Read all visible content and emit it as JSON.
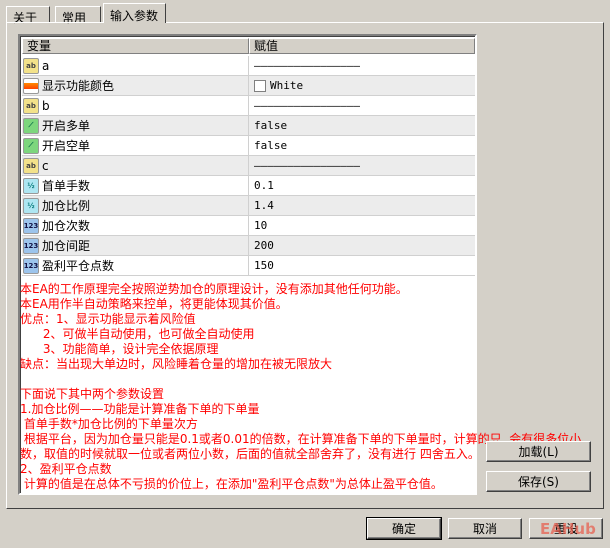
{
  "tabs": [
    {
      "label": "关于"
    },
    {
      "label": "常用"
    },
    {
      "label": "输入参数"
    }
  ],
  "table": {
    "headers": [
      "变量",
      "赋值"
    ],
    "rows": [
      {
        "icon": "string",
        "name": "a",
        "value": "————————————————"
      },
      {
        "icon": "color",
        "name": "显示功能颜色",
        "value": "White"
      },
      {
        "icon": "string",
        "name": "b",
        "value": "————————————————"
      },
      {
        "icon": "bool",
        "name": "开启多单",
        "value": "false"
      },
      {
        "icon": "bool",
        "name": "开启空单",
        "value": "false"
      },
      {
        "icon": "string",
        "name": "c",
        "value": "————————————————"
      },
      {
        "icon": "double",
        "name": "首单手数",
        "value": "0.1"
      },
      {
        "icon": "double",
        "name": "加仓比例",
        "value": "1.4"
      },
      {
        "icon": "integer",
        "name": "加仓次数",
        "value": "10"
      },
      {
        "icon": "integer",
        "name": "加仓间距",
        "value": "200"
      },
      {
        "icon": "integer",
        "name": "盈利平仓点数",
        "value": "150"
      }
    ]
  },
  "icon_labels": {
    "string": "ab",
    "color": "",
    "bool": "⟋",
    "double": "½",
    "integer": "123"
  },
  "description": [
    "本EA的工作原理完全按照逆势加仓的原理设计，没有添加其他任何功能。",
    "本EA用作半自动策略来控单，将更能体现其价值。",
    "优点：1、显示功能显示着风险值",
    "      2、可做半自动使用，也可做全自动使用",
    "      3、功能简单，设计完全依据原理",
    "缺点：当出现大单边时，风险睡着仓量的增加在被无限放大",
    "",
    "下面说下其中两个参数设置",
    "1.加仓比例——功能是计算准备下单的下单量",
    " 首单手数*加仓比例的下单量次方",
    " 根据平台，因为加仓量只能是0.1或者0.01的倍数，在计算准备下单的下单量时，计算的只  会有很多位小",
    "数，取值的时候就取一位或者两位小数，后面的值就全部舍弃了，没有进行 四舍五入。",
    "2、盈利平仓点数",
    " 计算的值是在总体不亏损的价位上，在添加\"盈利平仓点数\"为总体止盈平仓值。"
  ],
  "buttons": {
    "load": "加载(L)",
    "save": "保存(S)",
    "ok": "确定",
    "cancel": "取消",
    "reset": "重设"
  },
  "watermark": "EAHub",
  "colors": {
    "text": "#ff0000",
    "bg": "#d4d0c8"
  }
}
